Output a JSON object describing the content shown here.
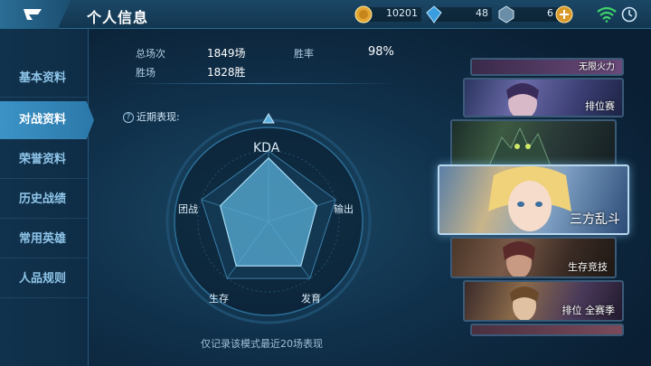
{
  "header": {
    "title": "个人信息",
    "gold": "10201",
    "gems": "48",
    "vouchers": "6"
  },
  "sidebar": {
    "items": [
      {
        "label": "基本资料"
      },
      {
        "label": "对战资料"
      },
      {
        "label": "荣誉资料"
      },
      {
        "label": "历史战绩"
      },
      {
        "label": "常用英雄"
      },
      {
        "label": "人品规则"
      }
    ],
    "active_index": 1
  },
  "stats": {
    "total_matches_label": "总场次",
    "total_matches": "1849场",
    "win_rate_label": "胜率",
    "win_rate": "98%",
    "wins_label": "胜场",
    "wins": "1828胜"
  },
  "radar": {
    "title": "近期表现:",
    "axes": [
      "KDA",
      "输出",
      "发育",
      "生存",
      "团战"
    ],
    "values": [
      0.9,
      0.72,
      0.78,
      0.78,
      0.72
    ],
    "note": "仅记录该模式最近20场表现"
  },
  "modes": [
    {
      "label": "无限火力"
    },
    {
      "label": "排位赛"
    },
    {
      "label": ""
    },
    {
      "label": "三方乱斗"
    },
    {
      "label": "生存竞技"
    },
    {
      "label": "排位 全赛季"
    }
  ],
  "colors": {
    "accent": "#3c93c6",
    "radar_fill": "#5aaed6"
  }
}
